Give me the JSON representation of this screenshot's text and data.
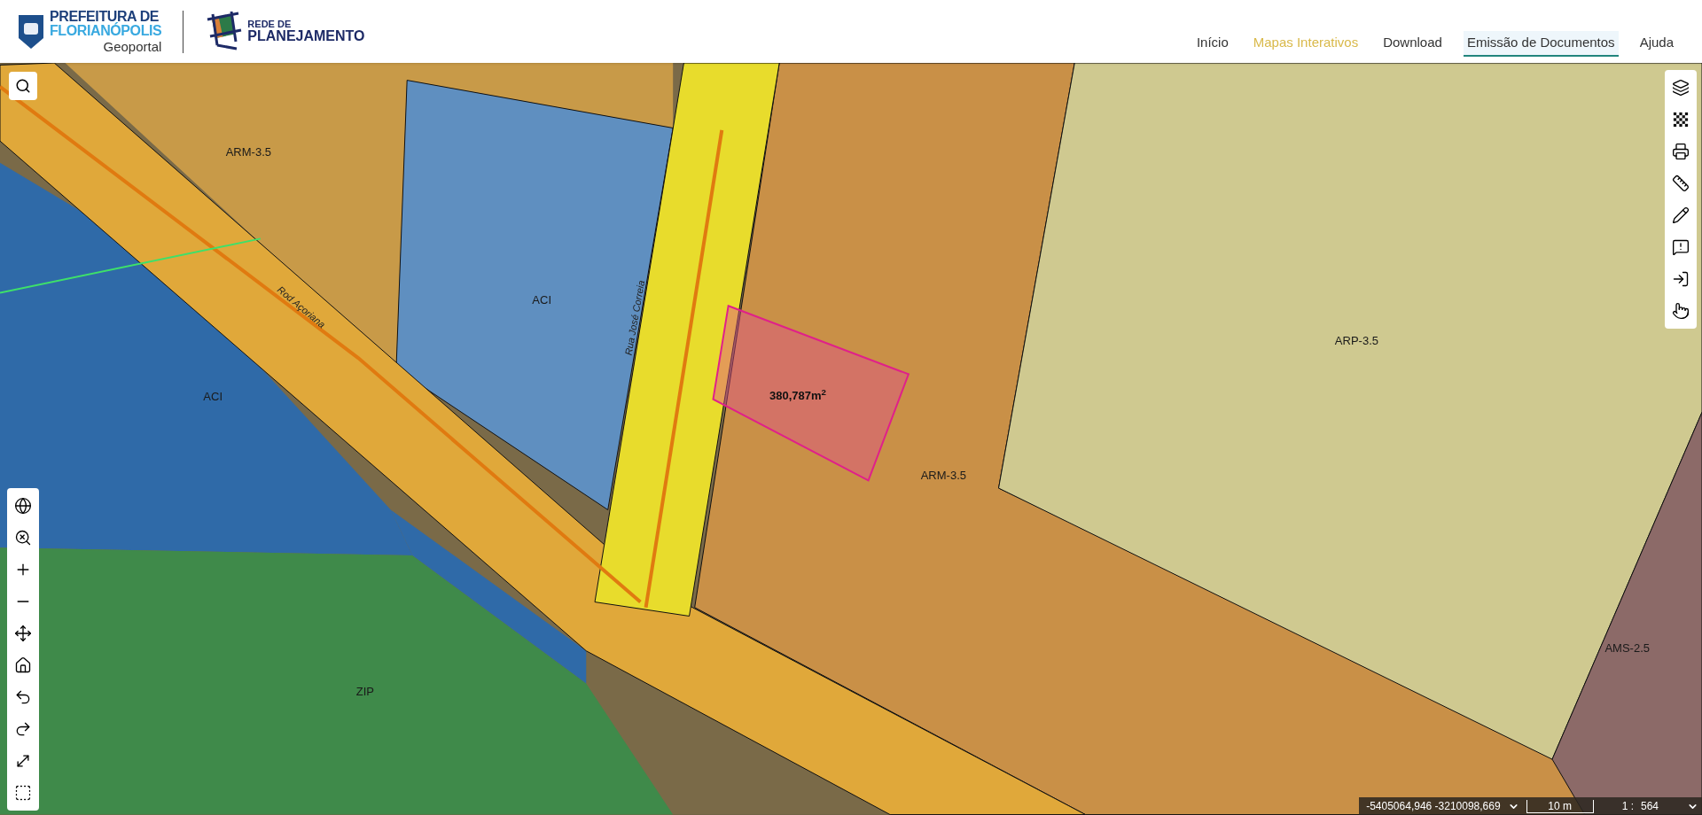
{
  "header": {
    "logo_line1": "PREFEITURA DE",
    "logo_line2": "FLORIANÓPOLIS",
    "logo_subtitle": "Geoportal",
    "partner_small": "REDE DE",
    "partner_large": "PLANEJAMENTO"
  },
  "nav": [
    {
      "label": "Início",
      "selected": false,
      "current": false
    },
    {
      "label": "Mapas Interativos",
      "selected": false,
      "current": true
    },
    {
      "label": "Download",
      "selected": false,
      "current": false
    },
    {
      "label": "Emissão de Documentos",
      "selected": true,
      "current": false
    },
    {
      "label": "Ajuda",
      "selected": false,
      "current": false
    }
  ],
  "map": {
    "labels": [
      {
        "text": "ARM-3.5",
        "kind": "zone"
      },
      {
        "text": "ACI",
        "kind": "zone"
      },
      {
        "text": "ACI",
        "kind": "zone"
      },
      {
        "text": "Rod Açoriana",
        "kind": "road"
      },
      {
        "text": "Rua José Correia",
        "kind": "road"
      },
      {
        "text": "ARP-3.5",
        "kind": "zone"
      },
      {
        "text": "ARM-3.5",
        "kind": "zone"
      },
      {
        "text": "AMS-2.5",
        "kind": "zone"
      },
      {
        "text": "ZIP",
        "kind": "zone"
      }
    ],
    "parcel_area": "380,787m$^{2}$"
  },
  "status_bar": {
    "coordinates": "-5405064,946 -3210098,669",
    "scale_bar": "10 m",
    "scale_prefix": "1 :",
    "scale_value": "564"
  }
}
